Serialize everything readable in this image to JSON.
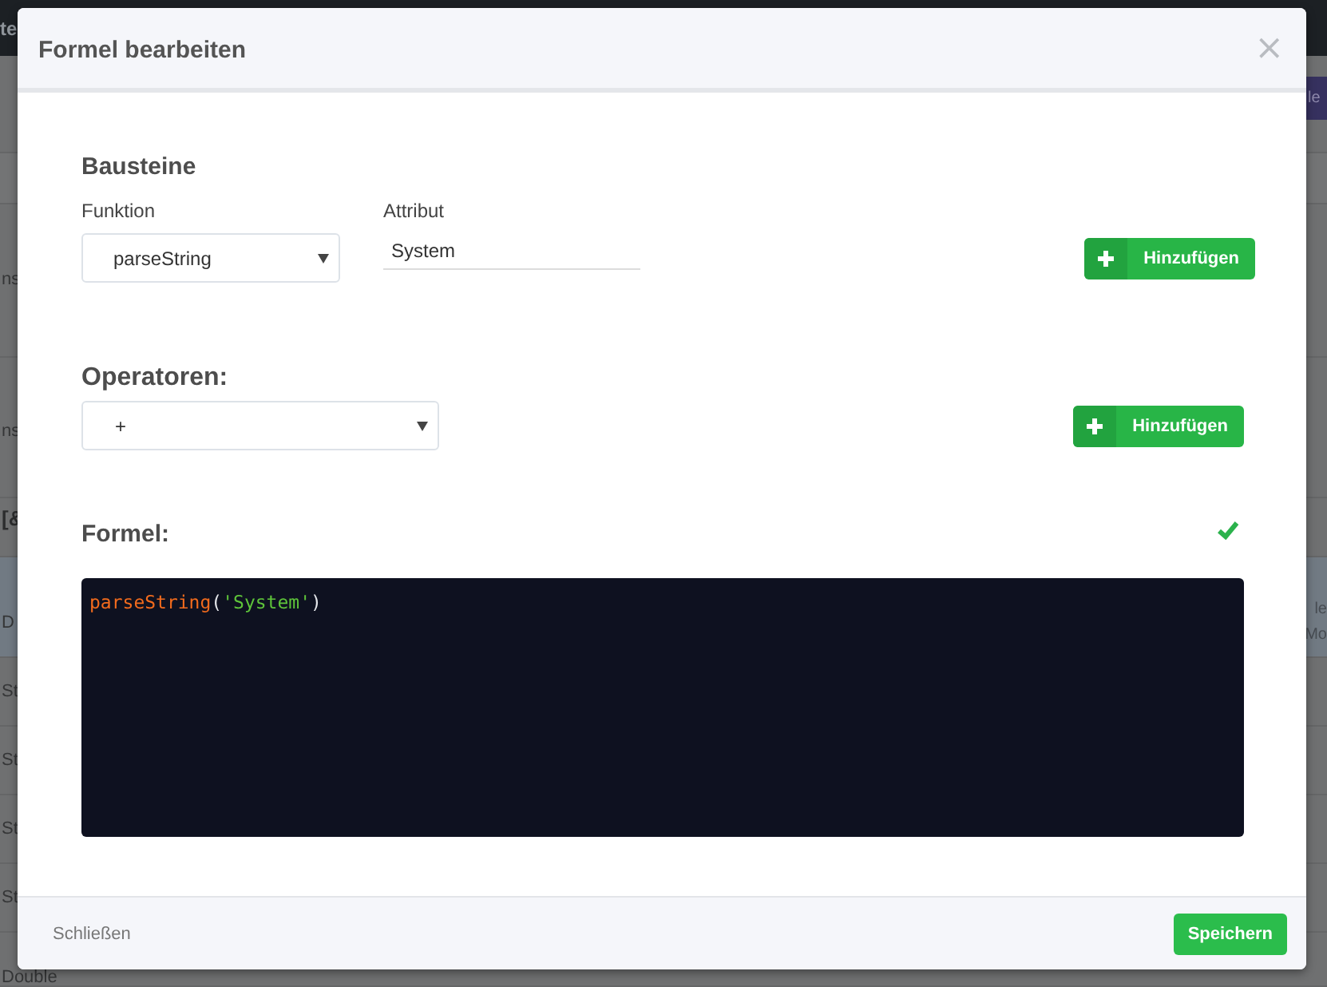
{
  "background": {
    "top_bar": {
      "title": "te"
    },
    "top_button": {
      "label": "le"
    },
    "rows": [
      {
        "kind": "row",
        "left": "ns"
      },
      {
        "kind": "row",
        "left": "ns"
      },
      {
        "kind": "section",
        "left": "[&"
      },
      {
        "kind": "header",
        "left": "D",
        "right": [
          "le",
          "Mo"
        ]
      },
      {
        "kind": "row",
        "left": "St"
      },
      {
        "kind": "row",
        "left": "St"
      },
      {
        "kind": "row",
        "left": "St"
      },
      {
        "kind": "row",
        "left": "St"
      },
      {
        "kind": "row",
        "left": "Double"
      }
    ]
  },
  "dialog": {
    "title": "Formel bearbeiten",
    "close": "×",
    "building_blocks": {
      "heading": "Bausteine",
      "function": {
        "label": "Funktion",
        "value": "parseString"
      },
      "attribute": {
        "label": "Attribut",
        "value": "System"
      },
      "add_button": "Hinzufügen"
    },
    "operators": {
      "heading": "Operatoren:",
      "value": "+",
      "add_button": "Hinzufügen"
    },
    "formula": {
      "heading": "Formel:",
      "valid": true,
      "code": [
        {
          "kind": "function",
          "text": "parseString"
        },
        {
          "kind": "punctuation",
          "text": "("
        },
        {
          "kind": "string",
          "text": "'System'"
        },
        {
          "kind": "punctuation",
          "text": ")"
        }
      ]
    },
    "footer": {
      "close": "Schließen",
      "save": "Speichern"
    }
  }
}
